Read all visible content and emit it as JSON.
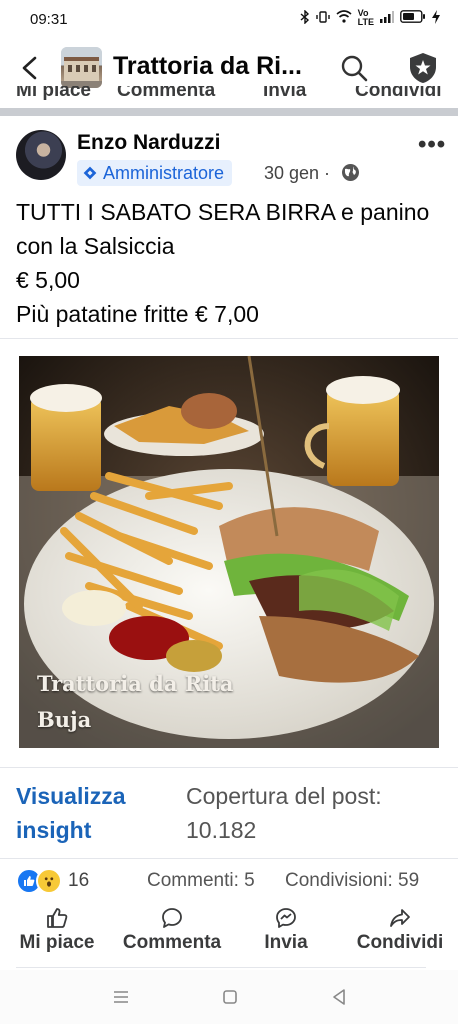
{
  "status_bar": {
    "time": "09:31",
    "icons": [
      "bluetooth-icon",
      "vibrate-icon",
      "wifi-icon",
      "volte-icon",
      "signal-icon",
      "battery-icon",
      "charging-icon"
    ]
  },
  "header": {
    "title": "Trattoria da Ri...",
    "back_icon": "back-arrow-icon",
    "search_icon": "search-icon",
    "shield_icon": "shield-star-icon"
  },
  "partial_actions": [
    "Mi piace",
    "Commenta",
    "Invia",
    "Condividi"
  ],
  "post": {
    "author": "Enzo Narduzzi",
    "role": "Amministratore",
    "date": "30 gen ·",
    "text": "TUTTI I SABATO  SERA BIRRA e panino con la Salsiccia\n € 5,00\nPiù patatine fritte € 7,00",
    "photo_caption": "Trattoria da Rita\nBuja"
  },
  "insights": {
    "link": "Visualizza\ninsight",
    "reach": "Copertura del post:\n10.182"
  },
  "stats": {
    "reactions": "16",
    "comments": "Commenti: 5",
    "shares": "Condivisioni: 59"
  },
  "actions": {
    "like": "Mi piace",
    "comment": "Commenta",
    "send": "Invia",
    "share": "Condividi"
  },
  "colors": {
    "accent": "#1b64b8",
    "badge_bg": "#e7f0fd",
    "badge_text": "#1b64d8",
    "divider": "#c9ccd1"
  }
}
